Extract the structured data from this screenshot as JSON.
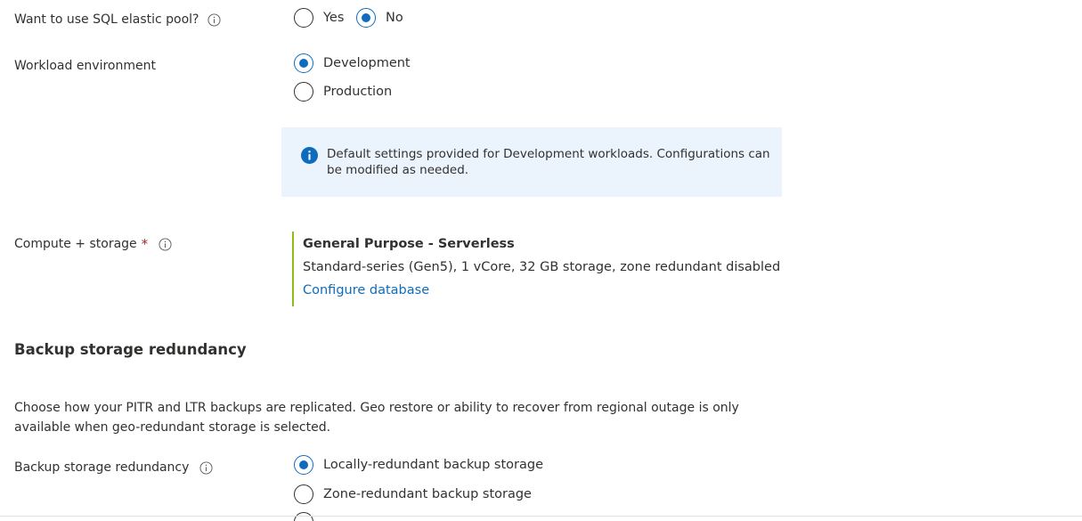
{
  "elastic_pool": {
    "label": "Want to use SQL elastic pool?",
    "options": [
      {
        "label": "Yes",
        "checked": false
      },
      {
        "label": "No",
        "checked": true
      }
    ]
  },
  "workload": {
    "label": "Workload environment",
    "options": [
      {
        "label": "Development",
        "checked": true
      },
      {
        "label": "Production",
        "checked": false
      }
    ],
    "info_text": "Default settings provided for Development workloads. Configurations can be modified as needed."
  },
  "compute": {
    "label": "Compute + storage",
    "required_mark": "*",
    "title": "General Purpose - Serverless",
    "description": "Standard-series (Gen5), 1 vCore, 32 GB storage, zone redundant disabled",
    "link": "Configure database"
  },
  "backup": {
    "section_title": "Backup storage redundancy",
    "description": "Choose how your PITR and LTR backups are replicated. Geo restore or ability to recover from regional outage is only available when geo-redundant storage is selected.",
    "label": "Backup storage redundancy",
    "options": [
      {
        "label": "Locally-redundant backup storage",
        "checked": true
      },
      {
        "label": "Zone-redundant backup storage",
        "checked": false
      }
    ]
  },
  "colors": {
    "accent": "#0f6cbd",
    "info_bg": "#ebf3fc",
    "card_border": "#8cbd18",
    "required": "#a4262c"
  }
}
